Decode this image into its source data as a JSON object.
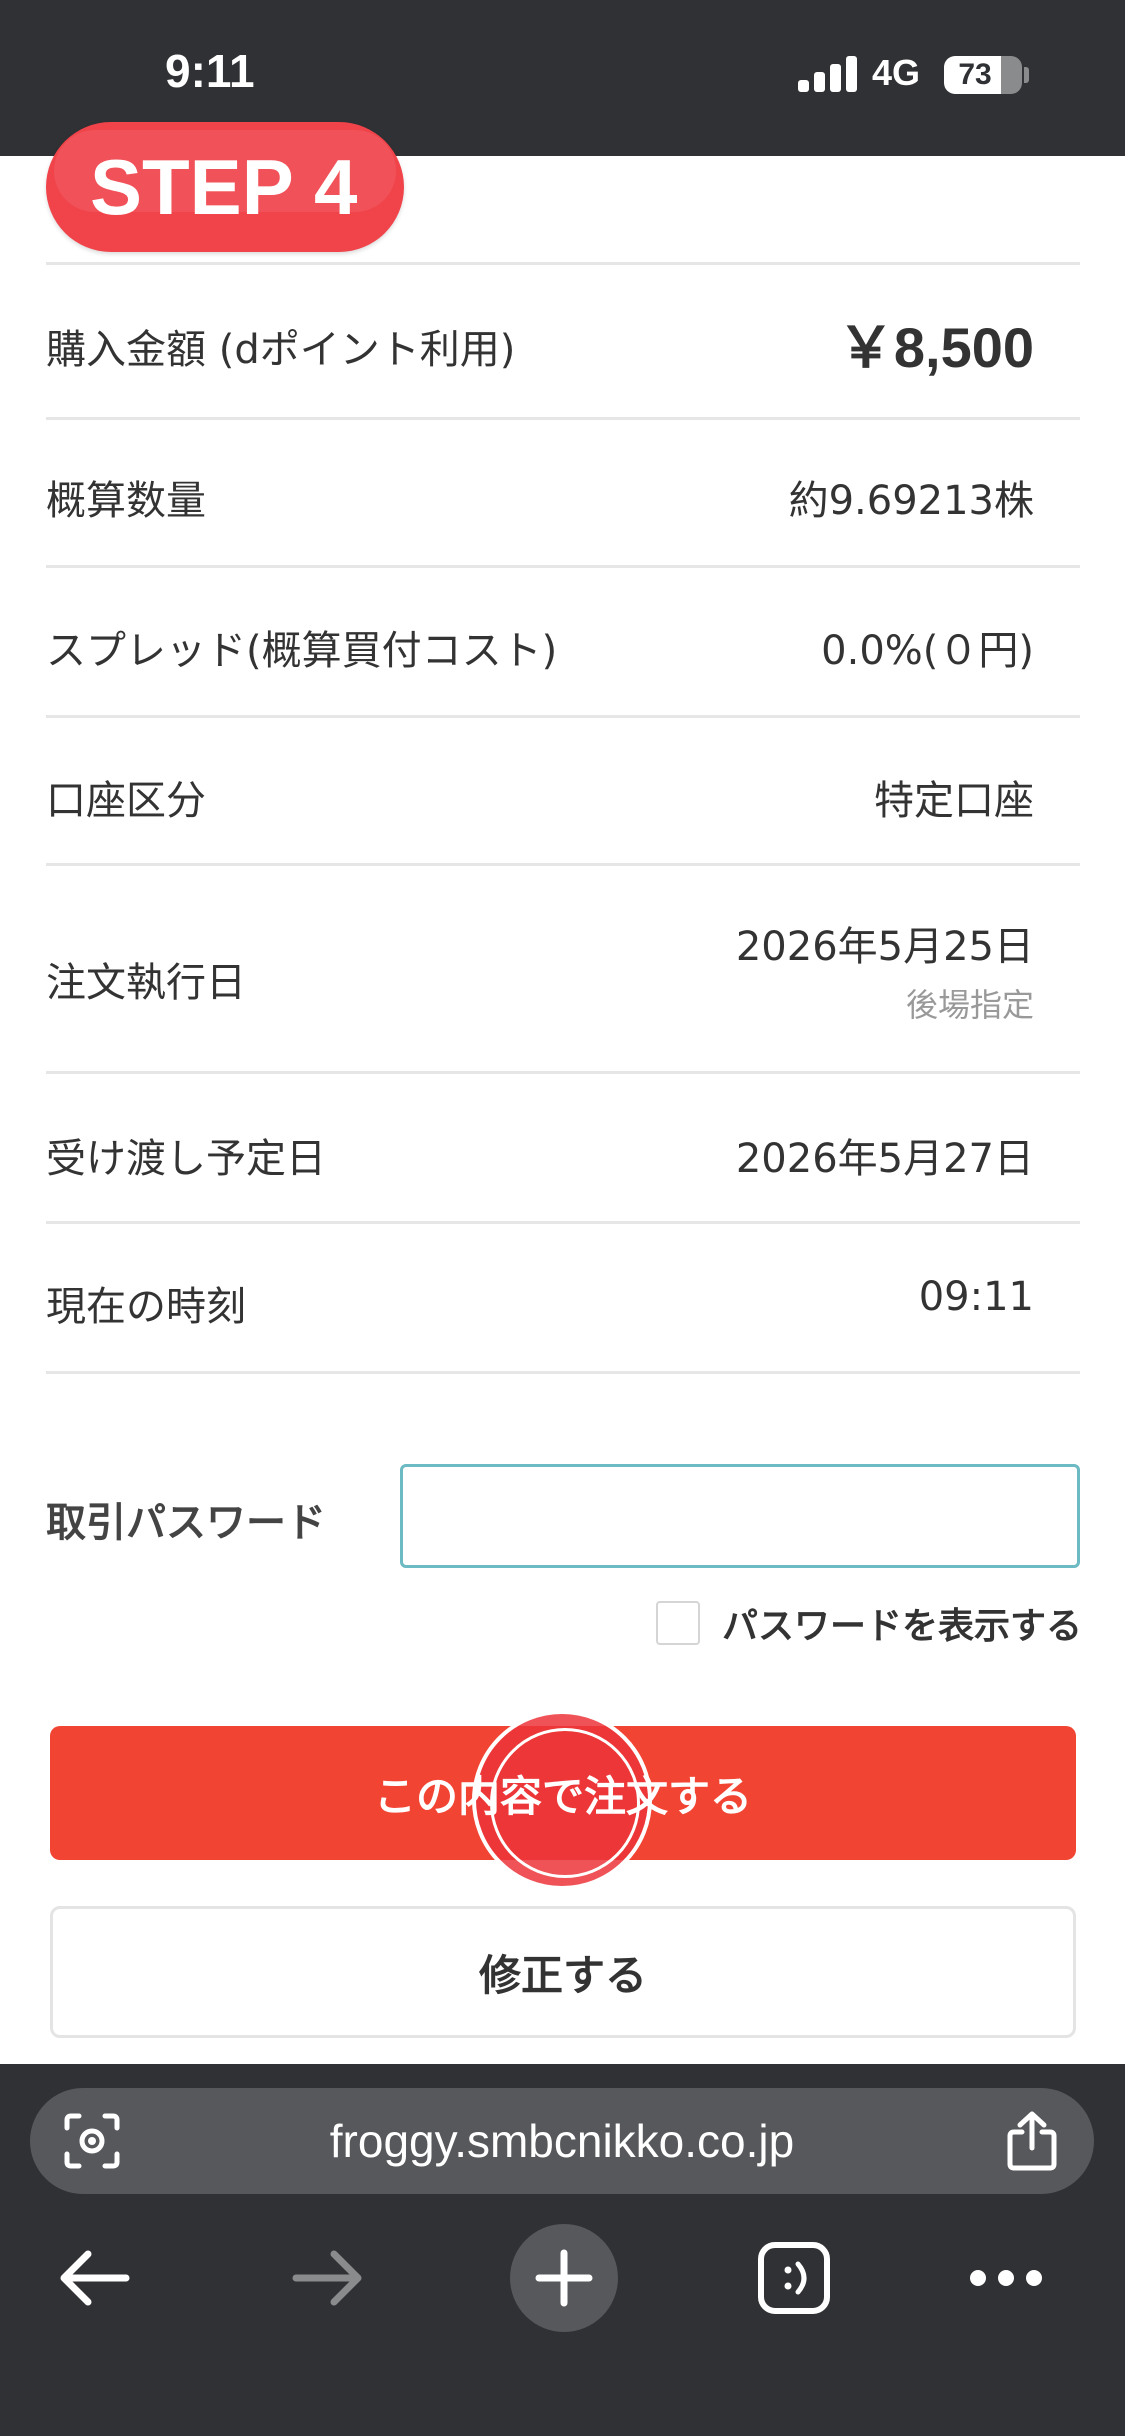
{
  "status_bar": {
    "time": "9:11",
    "network": "4G",
    "battery_percent": "73",
    "battery_level": 0.73
  },
  "step_badge": "STEP 4",
  "rows": [
    {
      "label": "購入金額 (dポイント利用)",
      "value": "￥8,500"
    },
    {
      "label": "概算数量",
      "value": "約9.69213株"
    },
    {
      "label": "スプレッド(概算買付コスト)",
      "value": "0.0%(０円)"
    },
    {
      "label": "口座区分",
      "value": "特定口座"
    },
    {
      "label": "注文執行日",
      "value": "2026年5月25日",
      "sub": "後場指定"
    },
    {
      "label": "受け渡し予定日",
      "value": "2026年5月27日"
    },
    {
      "label": "現在の時刻",
      "value": "09:11"
    }
  ],
  "password": {
    "label": "取引パスワード",
    "value": "",
    "show_label": "パスワードを表示する"
  },
  "buttons": {
    "order": "この内容で注文する",
    "edit": "修正する"
  },
  "browser": {
    "url": "froggy.smbcnikko.co.jp",
    "icons": [
      "lens-icon",
      "share-icon",
      "back-icon",
      "forward-icon",
      "new-tab-icon",
      "tabs-icon",
      "more-icon"
    ]
  },
  "colors": {
    "accent_red": "#f24433",
    "badge_red": "#f0434a",
    "input_border": "#6cbac3",
    "chrome_dark": "#2f3134"
  }
}
